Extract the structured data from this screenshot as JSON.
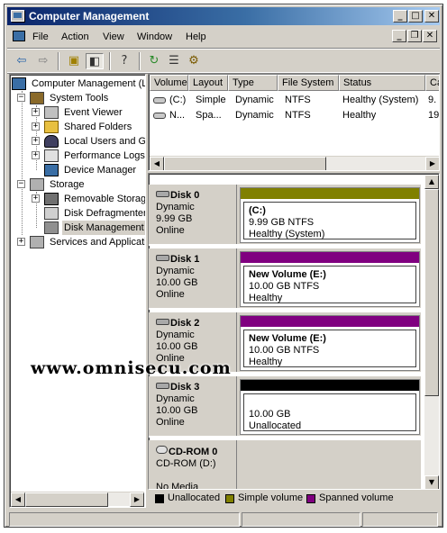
{
  "window": {
    "title": "Computer Management"
  },
  "menu": {
    "file": "File",
    "action": "Action",
    "view": "View",
    "window": "Window",
    "help": "Help"
  },
  "tree": {
    "root": "Computer Management (L",
    "system_tools": "System Tools",
    "event_viewer": "Event Viewer",
    "shared_folders": "Shared Folders",
    "local_users": "Local Users and Gr",
    "performance_logs": "Performance Logs",
    "device_manager": "Device Manager",
    "storage": "Storage",
    "removable_storage": "Removable Storag",
    "disk_defragmenter": "Disk Defragmenter",
    "disk_management": "Disk Management",
    "services_apps": "Services and Applicatio"
  },
  "volume_list": {
    "headers": [
      "Volume",
      "Layout",
      "Type",
      "File System",
      "Status",
      "Ca"
    ],
    "rows": [
      [
        "(C:)",
        "Simple",
        "Dynamic",
        "NTFS",
        "Healthy (System)",
        "9."
      ],
      [
        "N...",
        "Spa...",
        "Dynamic",
        "NTFS",
        "Healthy",
        "19"
      ]
    ]
  },
  "disks": [
    {
      "name": "Disk 0",
      "type": "Dynamic",
      "size": "9.99 GB",
      "state": "Online",
      "bar_color": "#808000",
      "vol": "(C:)",
      "detail": "9.99 GB NTFS",
      "status": "Healthy (System)"
    },
    {
      "name": "Disk 1",
      "type": "Dynamic",
      "size": "10.00 GB",
      "state": "Online",
      "bar_color": "#800080",
      "vol": "New Volume  (E:)",
      "detail": "10.00 GB NTFS",
      "status": "Healthy"
    },
    {
      "name": "Disk 2",
      "type": "Dynamic",
      "size": "10.00 GB",
      "state": "Online",
      "bar_color": "#800080",
      "vol": "New Volume  (E:)",
      "detail": "10.00 GB NTFS",
      "status": "Healthy"
    },
    {
      "name": "Disk 3",
      "type": "Dynamic",
      "size": "10.00 GB",
      "state": "Online",
      "bar_color": "#000000",
      "vol": "",
      "detail": "10.00 GB",
      "status": "Unallocated"
    }
  ],
  "cdrom": {
    "name": "CD-ROM 0",
    "drive": "CD-ROM (D:)",
    "media": "No Media"
  },
  "legend": [
    {
      "label": "Unallocated",
      "color": "#000000"
    },
    {
      "label": "Simple volume",
      "color": "#808000"
    },
    {
      "label": "Spanned volume",
      "color": "#800080"
    }
  ],
  "watermark": "www.omnisecu.com"
}
